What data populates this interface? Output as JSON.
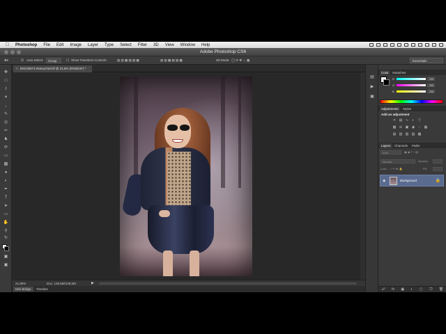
{
  "menubar": {
    "apple_icon": "apple-logo-icon",
    "items": [
      "Photoshop",
      "File",
      "Edit",
      "Image",
      "Layer",
      "Type",
      "Select",
      "Filter",
      "3D",
      "View",
      "Window",
      "Help"
    ]
  },
  "window": {
    "title": "Adobe Photoshop CS6"
  },
  "options": {
    "auto_select_label": "Auto-Select:",
    "auto_select_value": "Group",
    "transform_label": "Show Transform Controls",
    "mode_3d_label": "3D Mode:",
    "workspace": "Essentials"
  },
  "document": {
    "tab_label": "DSC00571-Retouched.tif @ 21,8% (RGB/16*) *",
    "zoom": "21,86%",
    "doc_size": "Doc: 139,5M/139,5M"
  },
  "bottom_tabs": [
    "Mini Bridge",
    "Timeline"
  ],
  "panels": {
    "color_tabs": [
      "Color",
      "Swatches"
    ],
    "color": {
      "channels": [
        {
          "label": "R",
          "value": "255",
          "gradient": "#ff3030"
        },
        {
          "label": "G",
          "value": "255",
          "gradient": "#30ff30"
        },
        {
          "label": "B",
          "value": "255",
          "gradient": "#3030ff"
        }
      ]
    },
    "adjustment_tabs": [
      "Adjustments",
      "Styles"
    ],
    "adjustments_title": "Add an adjustment",
    "layers_tabs": [
      "Layers",
      "Channels",
      "Paths"
    ],
    "layers": {
      "kind_label": "Kind",
      "blend_mode": "Normal",
      "opacity_label": "Opacity:",
      "lock_label": "Lock:",
      "fill_label": "Fill:",
      "layer_name": "Background"
    }
  },
  "colors": {
    "accent_layer_selected": "#5a6b90",
    "panel_bg": "#3a3a3a",
    "canvas_bg": "#282828"
  }
}
